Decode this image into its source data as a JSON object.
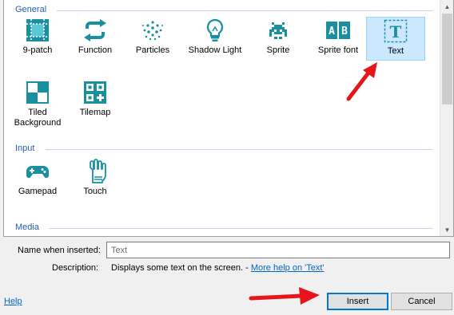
{
  "sections": {
    "general": "General",
    "input": "Input",
    "media": "Media"
  },
  "tiles": {
    "nine_patch": "9-patch",
    "function": "Function",
    "particles": "Particles",
    "shadow_light": "Shadow Light",
    "sprite": "Sprite",
    "sprite_font": "Sprite font",
    "text": "Text",
    "tiled_bg_line1": "Tiled",
    "tiled_bg_line2": "Background",
    "tilemap": "Tilemap",
    "gamepad": "Gamepad",
    "touch": "Touch"
  },
  "form": {
    "name_label": "Name when inserted:",
    "name_value": "Text",
    "description_label": "Description:",
    "description_text": "Displays some text on the screen. - ",
    "more_help_link": "More help on 'Text'"
  },
  "footer": {
    "help_link": "Help",
    "insert_button": "Insert",
    "cancel_button": "Cancel"
  },
  "colors": {
    "accent": "#1e5fb4",
    "selection": "#cce8ff",
    "link": "#0066cc",
    "arrow": "#e8141b",
    "icon_teal": "#1a8fa0"
  }
}
